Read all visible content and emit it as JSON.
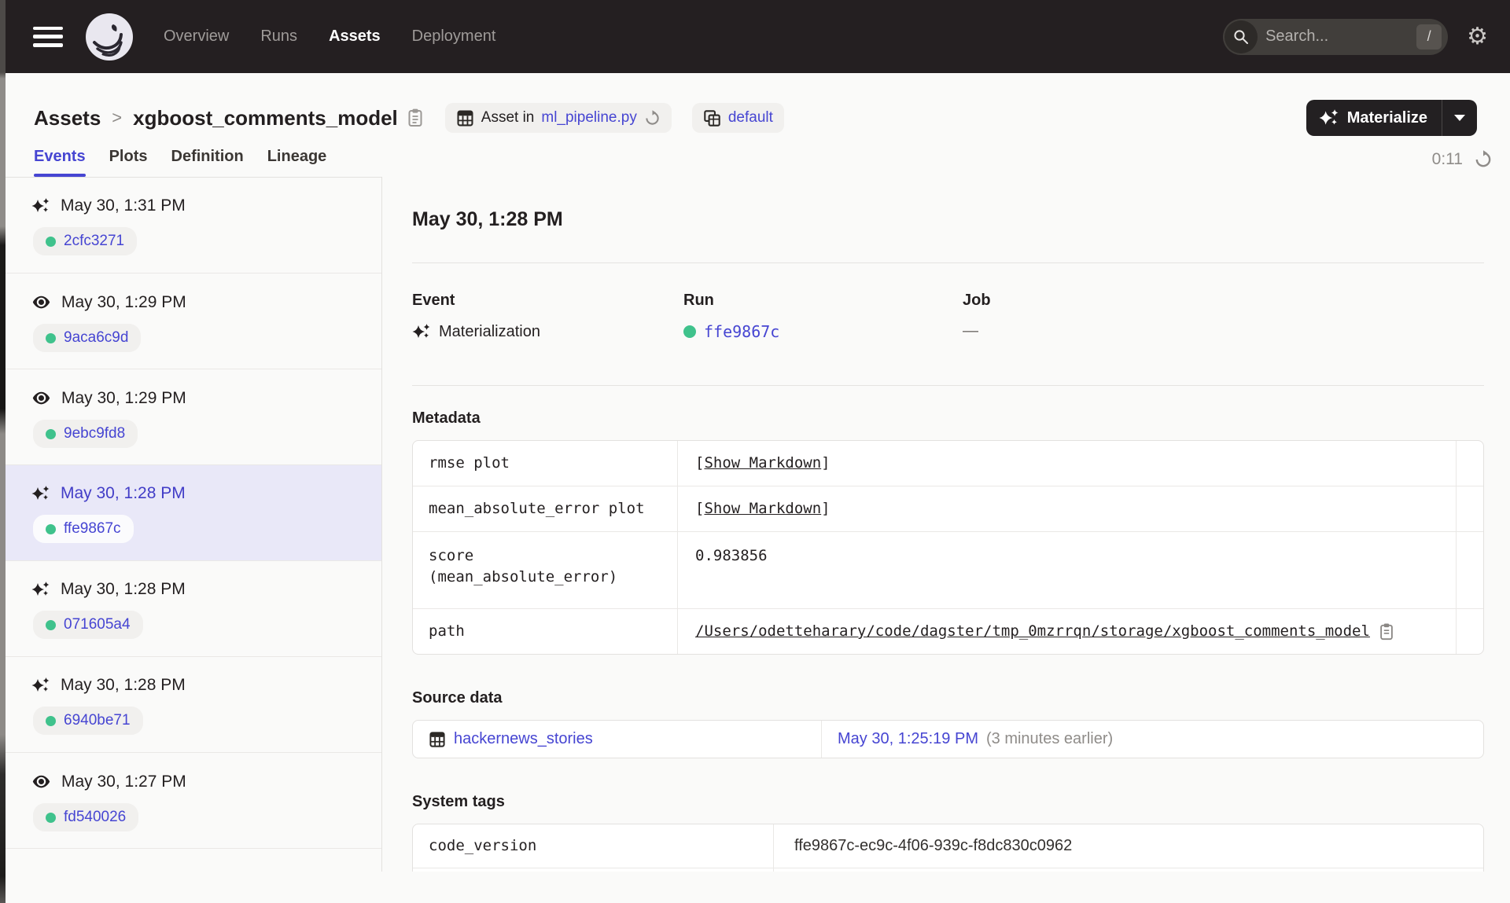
{
  "nav": {
    "items": [
      {
        "label": "Overview",
        "active": false
      },
      {
        "label": "Runs",
        "active": false
      },
      {
        "label": "Assets",
        "active": true
      },
      {
        "label": "Deployment",
        "active": false
      }
    ],
    "search": {
      "placeholder": "Search...",
      "shortcut": "/"
    }
  },
  "header": {
    "breadcrumb": {
      "section": "Assets",
      "separator": ">",
      "title": "xgboost_comments_model"
    },
    "asset_in_badge": {
      "prefix": "Asset in",
      "link": "ml_pipeline.py"
    },
    "repo_badge": {
      "label": "default"
    },
    "materialize": {
      "label": "Materialize"
    }
  },
  "tabs": {
    "items": [
      {
        "label": "Events",
        "active": true
      },
      {
        "label": "Plots",
        "active": false
      },
      {
        "label": "Definition",
        "active": false
      },
      {
        "label": "Lineage",
        "active": false
      }
    ],
    "timer": "0:11"
  },
  "sidebar": {
    "events": [
      {
        "type": "materialization",
        "timestamp": "May 30, 1:31 PM",
        "run_id": "2cfc3271",
        "selected": false
      },
      {
        "type": "observation",
        "timestamp": "May 30, 1:29 PM",
        "run_id": "9aca6c9d",
        "selected": false
      },
      {
        "type": "observation",
        "timestamp": "May 30, 1:29 PM",
        "run_id": "9ebc9fd8",
        "selected": false
      },
      {
        "type": "materialization",
        "timestamp": "May 30, 1:28 PM",
        "run_id": "ffe9867c",
        "selected": true
      },
      {
        "type": "materialization",
        "timestamp": "May 30, 1:28 PM",
        "run_id": "071605a4",
        "selected": false
      },
      {
        "type": "materialization",
        "timestamp": "May 30, 1:28 PM",
        "run_id": "6940be71",
        "selected": false
      },
      {
        "type": "observation",
        "timestamp": "May 30, 1:27 PM",
        "run_id": "fd540026",
        "selected": false
      }
    ]
  },
  "detail": {
    "heading": "May 30, 1:28 PM",
    "summary": {
      "event_label": "Event",
      "event_value": "Materialization",
      "run_label": "Run",
      "run_value": "ffe9867c",
      "job_label": "Job",
      "job_value": "—"
    },
    "metadata": {
      "heading": "Metadata",
      "rows": [
        {
          "key_lines": [
            "rmse plot"
          ],
          "bracket_open": "[",
          "link_text": "Show Markdown",
          "bracket_close": "]",
          "copy_icon": false
        },
        {
          "key_lines": [
            "mean_absolute_error plot"
          ],
          "bracket_open": "[",
          "link_text": "Show Markdown",
          "bracket_close": "]",
          "copy_icon": false
        },
        {
          "key_lines": [
            "score",
            "(mean_absolute_error)"
          ],
          "text": "0.983856",
          "copy_icon": false
        },
        {
          "key_lines": [
            "path"
          ],
          "link_text": "/Users/odetteharary/code/dagster/tmp_0mzrrqn/storage/xgboost_comments_model",
          "copy_icon": true
        }
      ]
    },
    "source_data": {
      "heading": "Source data",
      "asset_name": "hackernews_stories",
      "timestamp": "May 30, 1:25:19 PM",
      "relative_time": "(3 minutes earlier)"
    },
    "system_tags": {
      "heading": "System tags",
      "rows": [
        {
          "key": "code_version",
          "value": "ffe9867c-ec9c-4f06-939c-f8dc830c0962"
        },
        {
          "key": "",
          "value": ""
        }
      ]
    }
  },
  "colors": {
    "accent_link": "#4645d2",
    "success_green": "#3fc28c",
    "nav_background": "#241f21",
    "selected_row_background": "#e9e8f8"
  }
}
